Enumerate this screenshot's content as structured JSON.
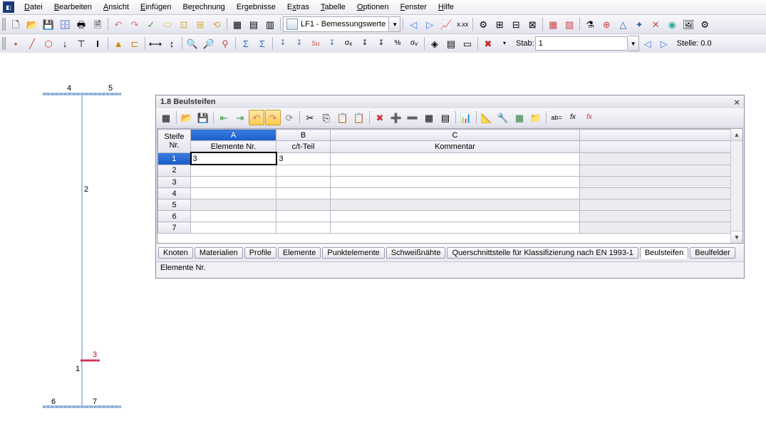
{
  "menu": {
    "items": [
      "Datei",
      "Bearbeiten",
      "Ansicht",
      "Einfügen",
      "Berechnung",
      "Ergebnisse",
      "Extras",
      "Tabelle",
      "Optionen",
      "Fenster",
      "Hilfe"
    ]
  },
  "toolbar1": {
    "lf_label": "LF1 - Bemessungswerte"
  },
  "toolbar2": {
    "stab_label": "Stab:",
    "stab_value": "1",
    "stelle_label": "Stelle:",
    "stelle_value": "0.0"
  },
  "drawing": {
    "nodes": {
      "1": "1",
      "2": "2",
      "3": "3",
      "4": "4",
      "5": "5",
      "6": "6",
      "7": "7"
    }
  },
  "panel": {
    "title": "1.8 Beulsteifen",
    "grid": {
      "corner_top": "Steife",
      "corner_bot": "Nr.",
      "col_letters": [
        "A",
        "B",
        "C"
      ],
      "col_headers": [
        "Elemente Nr.",
        "c/t-Teil",
        "Kommentar"
      ],
      "rows": [
        "1",
        "2",
        "3",
        "4",
        "5",
        "6",
        "7"
      ],
      "cell_a1": "3",
      "cell_b1": "3"
    },
    "tabs": [
      "Knoten",
      "Materialien",
      "Profile",
      "Elemente",
      "Punktelemente",
      "Schweißnähte",
      "Querschnittsteile für Klassifizierung nach EN 1993-1",
      "Beulsteifen",
      "Beulfelder"
    ],
    "status": "Elemente Nr."
  }
}
